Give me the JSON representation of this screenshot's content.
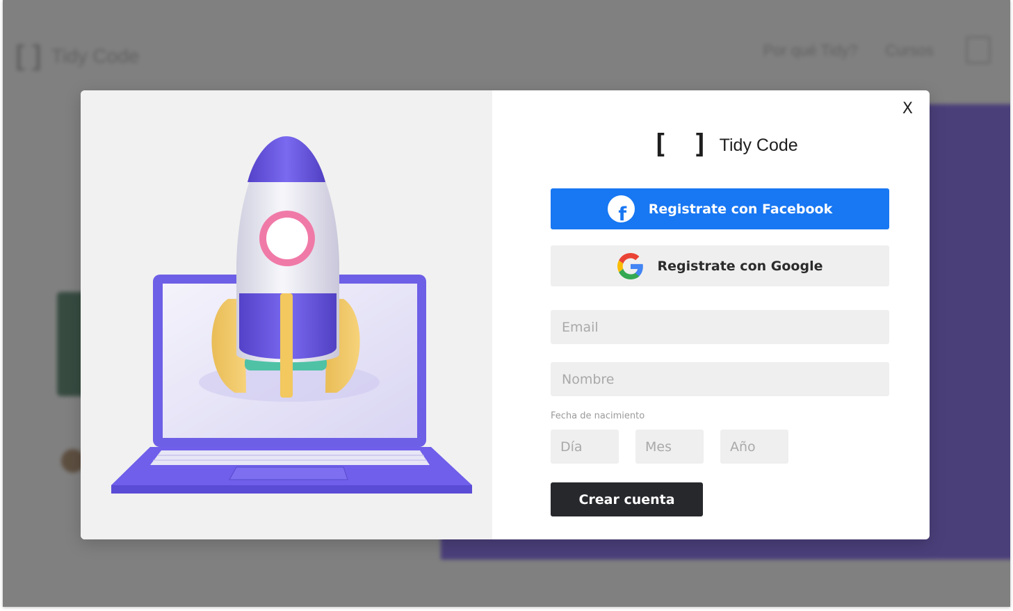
{
  "background_page": {
    "logo_mark": "[ ]",
    "logo_text": "Tidy Code",
    "nav": [
      "Por qué Tidy?",
      "Cursos"
    ]
  },
  "modal": {
    "close_label": "X",
    "brand": {
      "mark": "[ ]",
      "name": "Tidy Code"
    },
    "facebook_button": {
      "label": "Registrate con Facebook",
      "icon": "facebook-icon",
      "color": "#1877f2"
    },
    "google_button": {
      "label": "Registrate con Google",
      "icon": "google-icon"
    },
    "email": {
      "placeholder": "Email",
      "value": ""
    },
    "nombre": {
      "placeholder": "Nombre",
      "value": ""
    },
    "dob": {
      "label": "Fecha de nacimiento",
      "dia_placeholder": "Día",
      "mes_placeholder": "Mes",
      "anio_placeholder": "Año"
    },
    "submit_label": "Crear cuenta",
    "colors": {
      "accent": "#6c5ce7",
      "submit": "#27282c"
    }
  }
}
